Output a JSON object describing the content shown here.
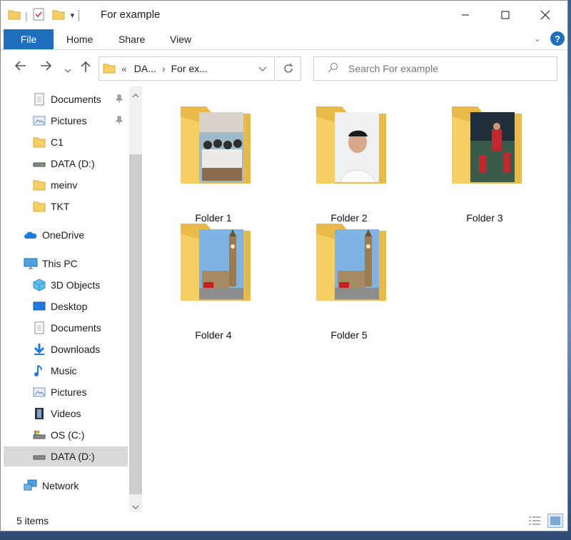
{
  "window": {
    "title": "For example",
    "qa_separator": "|"
  },
  "ribbon": {
    "tabs": [
      {
        "label": "File"
      },
      {
        "label": "Home"
      },
      {
        "label": "Share"
      },
      {
        "label": "View"
      }
    ]
  },
  "nav": {
    "address": {
      "overflow": "«",
      "crumbs": [
        "DA...",
        "For ex..."
      ]
    },
    "search": {
      "placeholder": "Search For example"
    }
  },
  "sidebar": {
    "items": [
      {
        "label": "Documents",
        "icon": "documents-icon",
        "pinned": true
      },
      {
        "label": "Pictures",
        "icon": "pictures-icon",
        "pinned": true
      },
      {
        "label": "C1",
        "icon": "folder-icon"
      },
      {
        "label": "DATA (D:)",
        "icon": "drive-icon"
      },
      {
        "label": "meinv",
        "icon": "folder-icon"
      },
      {
        "label": "TKT",
        "icon": "folder-icon"
      },
      {
        "label": "OneDrive",
        "icon": "onedrive-icon"
      },
      {
        "label": "This PC",
        "icon": "computer-icon"
      },
      {
        "label": "3D Objects",
        "icon": "3d-objects-icon"
      },
      {
        "label": "Desktop",
        "icon": "desktop-icon"
      },
      {
        "label": "Documents",
        "icon": "documents-icon"
      },
      {
        "label": "Downloads",
        "icon": "downloads-icon"
      },
      {
        "label": "Music",
        "icon": "music-icon"
      },
      {
        "label": "Pictures",
        "icon": "pictures-icon"
      },
      {
        "label": "Videos",
        "icon": "videos-icon"
      },
      {
        "label": "OS (C:)",
        "icon": "os-drive-icon"
      },
      {
        "label": "DATA (D:)",
        "icon": "drive-icon",
        "selected": true
      },
      {
        "label": "Network",
        "icon": "network-icon"
      }
    ]
  },
  "folders": [
    {
      "label": "Folder 1",
      "thumb": "class-photo"
    },
    {
      "label": "Folder 2",
      "thumb": "portrait"
    },
    {
      "label": "Folder 3",
      "thumb": "soccer"
    },
    {
      "label": "Folder 4",
      "thumb": "big-ben"
    },
    {
      "label": "Folder 5",
      "thumb": "big-ben"
    }
  ],
  "status": {
    "count": "5 items"
  },
  "colors": {
    "accent": "#1f6fbf",
    "folder": "#f5cf63",
    "selected": "#d9d9d9"
  }
}
